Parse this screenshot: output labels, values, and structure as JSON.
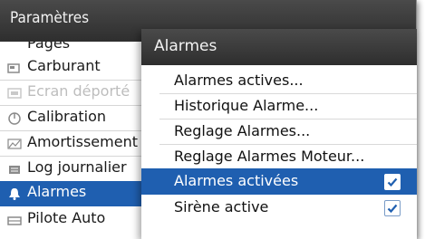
{
  "background_menu": {
    "title": "Paramètres",
    "partial_item": "Pages",
    "items": [
      {
        "label": "Carburant",
        "icon": "fuel-icon",
        "disabled": false,
        "selected": false
      },
      {
        "label": "Ecran déporté",
        "icon": "remote-display-icon",
        "disabled": true,
        "selected": false
      },
      {
        "label": "Calibration",
        "icon": "calibration-icon",
        "disabled": false,
        "selected": false
      },
      {
        "label": "Amortissement",
        "icon": "damping-icon",
        "disabled": false,
        "selected": false
      },
      {
        "label": "Log journalier",
        "icon": "log-icon",
        "disabled": false,
        "selected": false
      },
      {
        "label": "Alarmes",
        "icon": "bell-icon",
        "disabled": false,
        "selected": true
      },
      {
        "label": "Pilote Auto",
        "icon": "autopilot-icon",
        "disabled": false,
        "selected": false
      }
    ]
  },
  "alarm_menu": {
    "title": "Alarmes",
    "items": [
      {
        "label": "Alarmes actives...",
        "checkbox": false,
        "selected": false
      },
      {
        "label": "Historique Alarme...",
        "checkbox": false,
        "selected": false
      },
      {
        "label": "Reglage Alarmes...",
        "checkbox": false,
        "selected": false
      },
      {
        "label": "Reglage Alarmes Moteur...",
        "checkbox": false,
        "selected": false
      },
      {
        "label": "Alarmes activées",
        "checkbox": true,
        "checked": true,
        "selected": true
      },
      {
        "label": "Sirène active",
        "checkbox": true,
        "checked": true,
        "selected": false
      }
    ]
  },
  "colors": {
    "selection": "#1f5fb0",
    "header": "#3a3a3a",
    "checkmark": "#1f5fb0"
  }
}
